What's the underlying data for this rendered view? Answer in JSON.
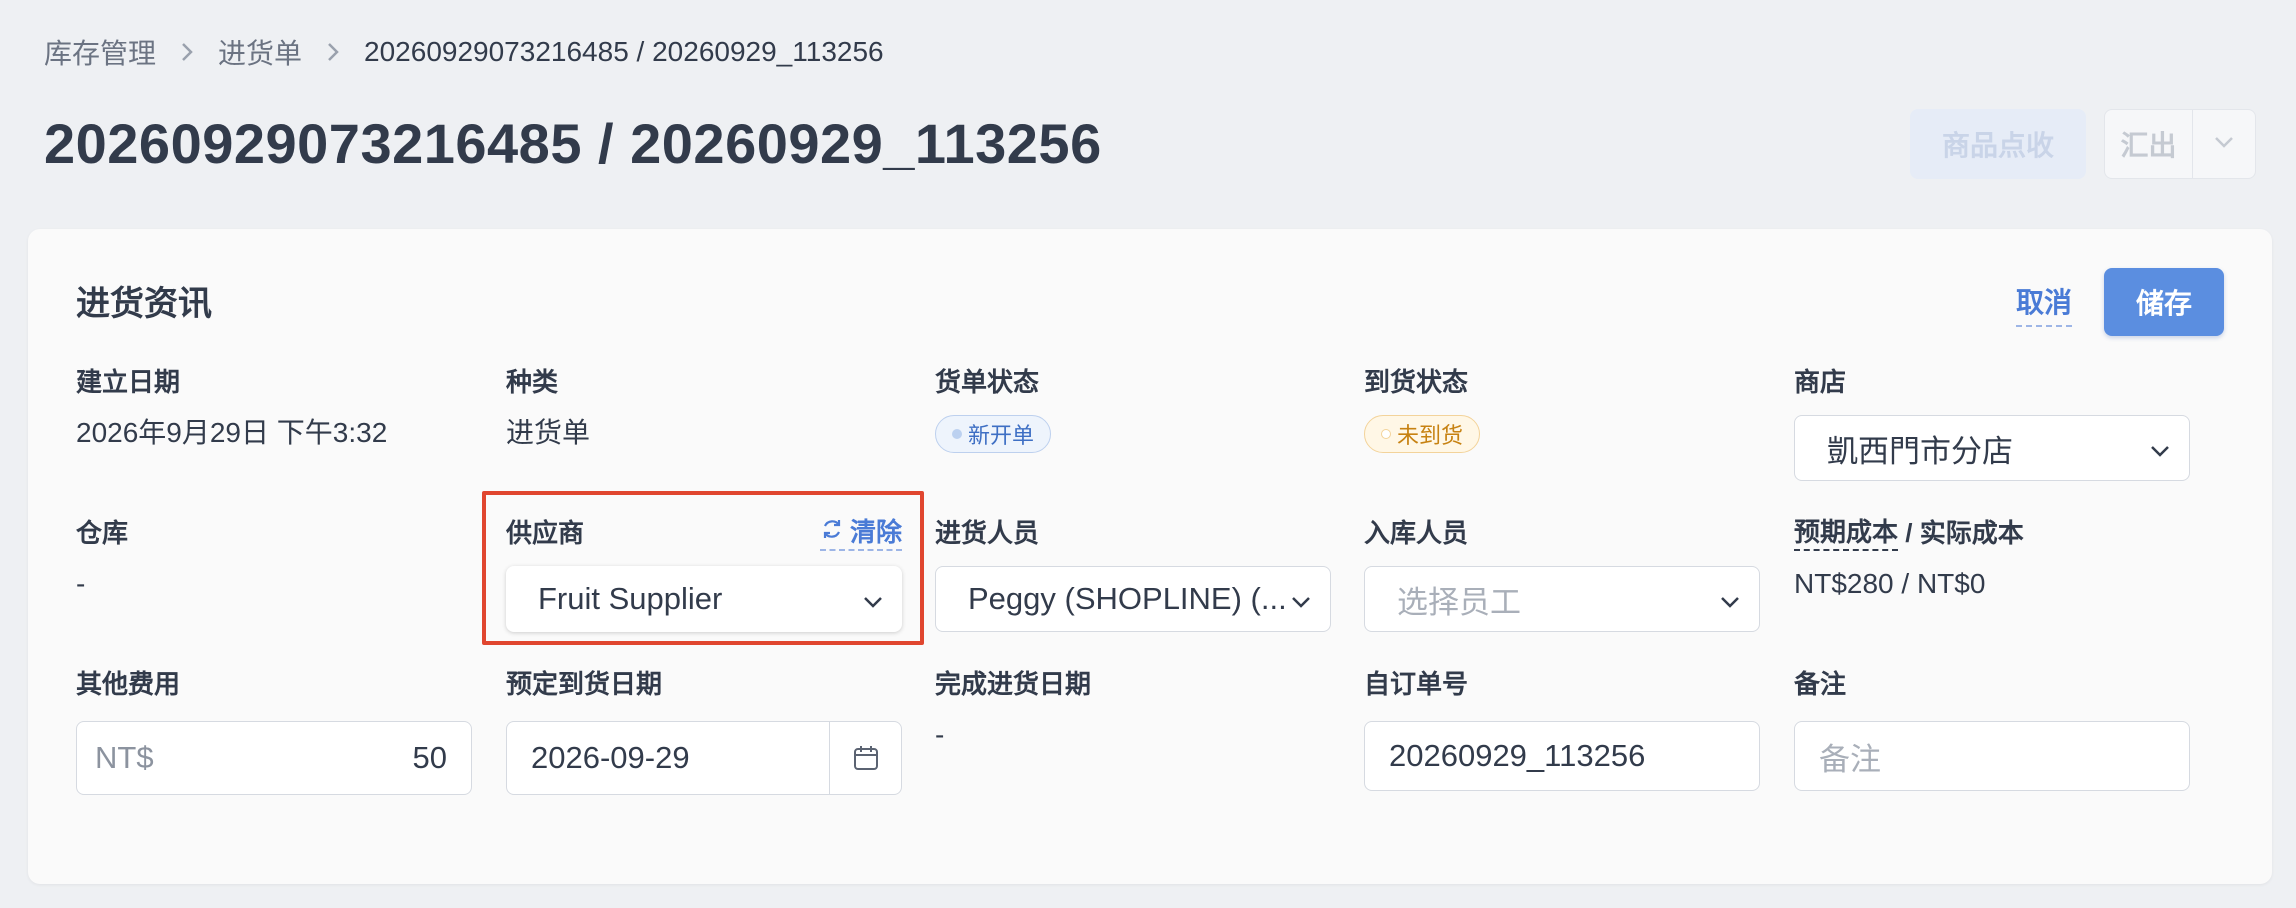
{
  "breadcrumb": {
    "items": [
      "库存管理",
      "进货单"
    ],
    "current": "20260929073216485 / 20260929_113256"
  },
  "page": {
    "title": "20260929073216485 / 20260929_113256",
    "receive_button": "商品点收",
    "export_button": "汇出"
  },
  "card": {
    "title": "进货资讯",
    "cancel": "取消",
    "save": "储存"
  },
  "fields": {
    "created_date": {
      "label": "建立日期",
      "value": "2026年9月29日 下午3:32"
    },
    "type": {
      "label": "种类",
      "value": "进货单"
    },
    "order_status": {
      "label": "货单状态",
      "value": "新开单"
    },
    "arrival_status": {
      "label": "到货状态",
      "value": "未到货"
    },
    "store": {
      "label": "商店",
      "value": "凱西門市分店"
    },
    "warehouse": {
      "label": "仓库",
      "value": "-"
    },
    "supplier": {
      "label": "供应商",
      "clear": "清除",
      "value": "Fruit Supplier"
    },
    "purchaser": {
      "label": "进货人员",
      "value": "Peggy (SHOPLINE) (..."
    },
    "stock_in_staff": {
      "label": "入库人员",
      "placeholder": "选择员工"
    },
    "cost": {
      "label_a": "预期成本",
      "label_sep": " / ",
      "label_b": "实际成本",
      "value": "NT$280 / NT$0"
    },
    "other_fees": {
      "label": "其他费用",
      "prefix": "NT$",
      "value": "50"
    },
    "expected_date": {
      "label": "预定到货日期",
      "value": "2026-09-29"
    },
    "completed_date": {
      "label": "完成进货日期",
      "value": "-"
    },
    "custom_order_no": {
      "label": "自订单号",
      "value": "20260929_113256"
    },
    "notes": {
      "label": "备注",
      "placeholder": "备注"
    }
  },
  "colors": {
    "accent": "#5b8ee0",
    "link": "#4a7bd6",
    "highlight": "#e0462f"
  }
}
